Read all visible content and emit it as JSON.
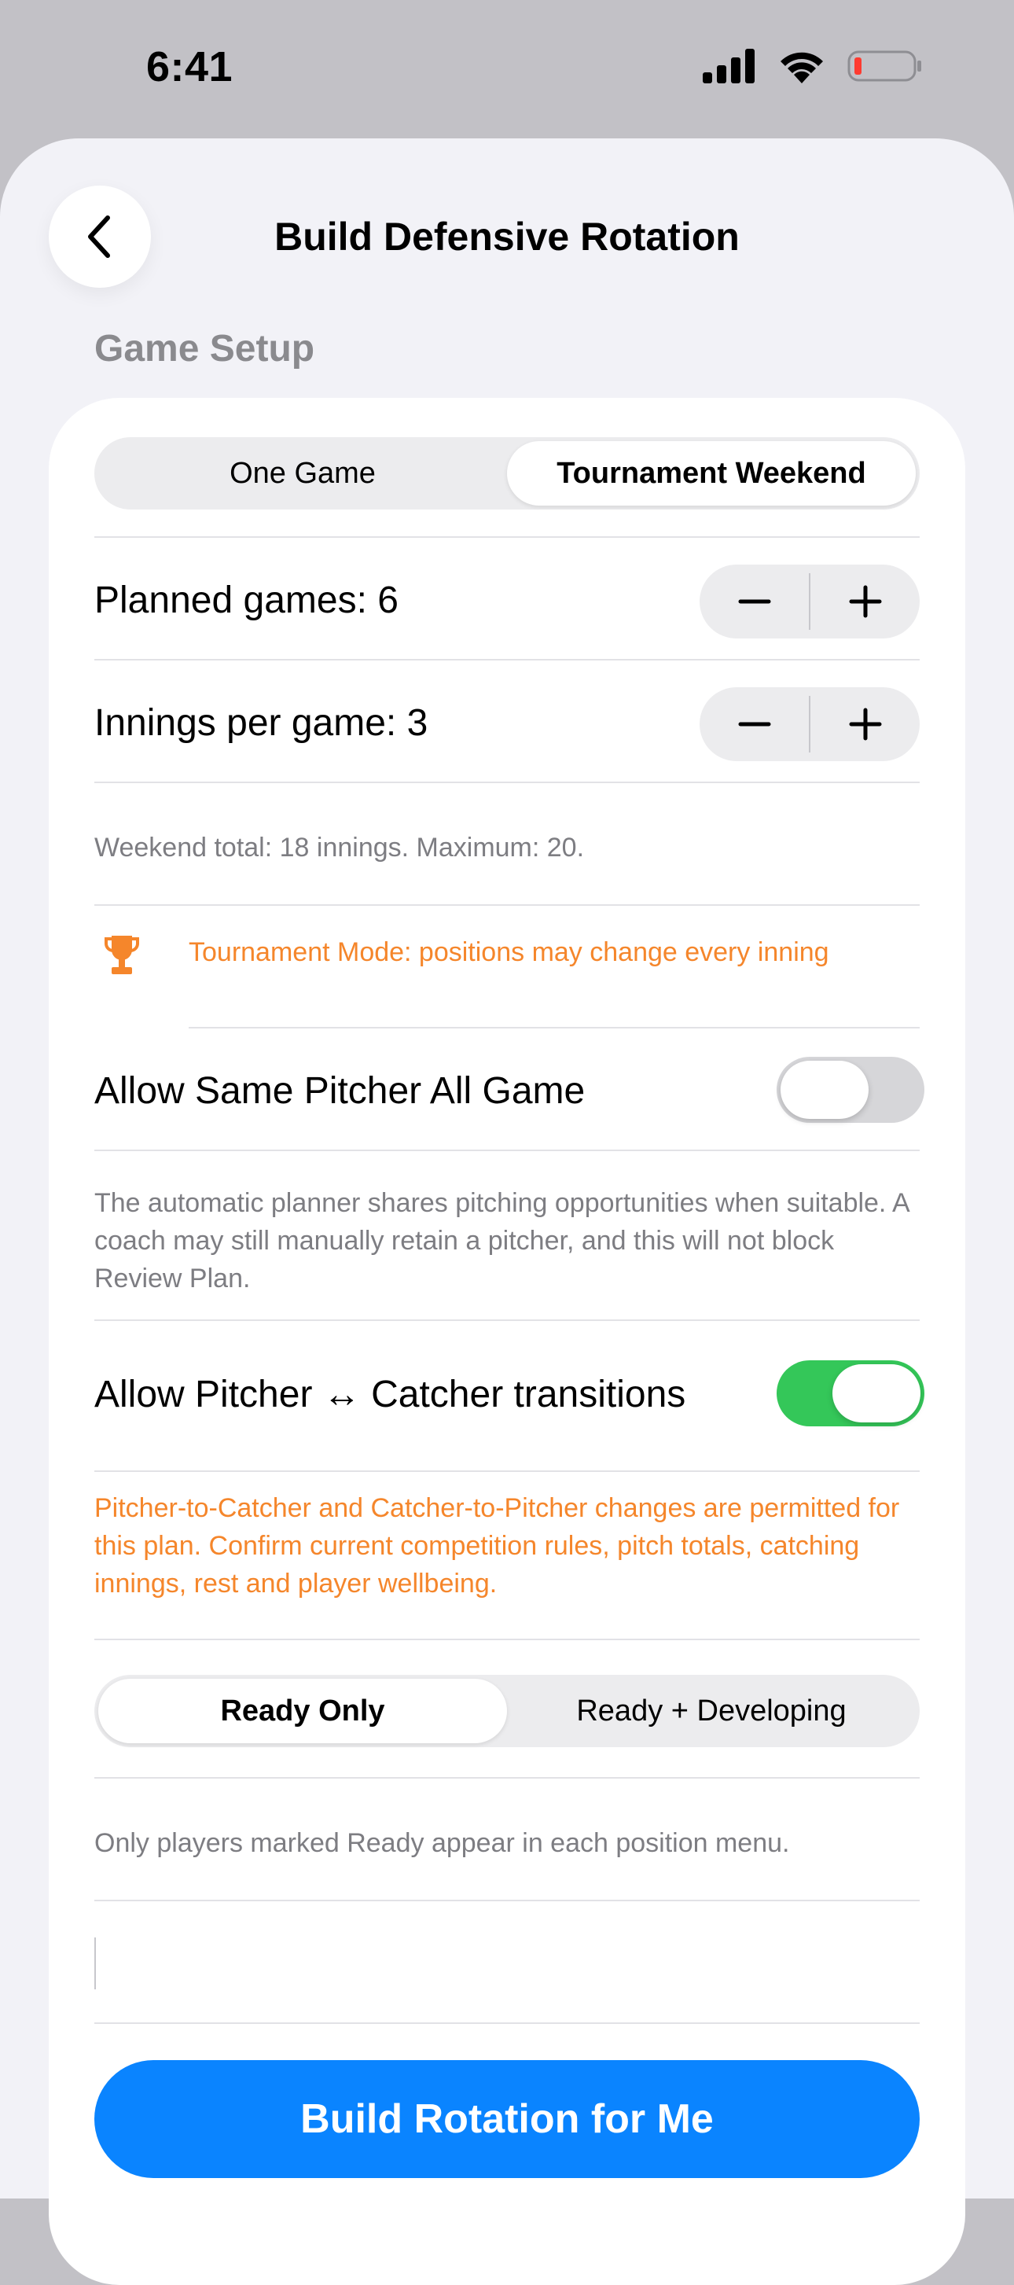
{
  "status_bar": {
    "time": "6:41"
  },
  "nav": {
    "title": "Build Defensive Rotation"
  },
  "section": {
    "header": "Game Setup"
  },
  "game_mode": {
    "options": [
      "One Game",
      "Tournament Weekend"
    ],
    "selected": "Tournament Weekend"
  },
  "planned_games": {
    "label": "Planned games: 6",
    "minus": "−",
    "plus": "+"
  },
  "innings": {
    "label": "Innings per game: 3",
    "minus": "−",
    "plus": "+"
  },
  "weekend_total": "Weekend total: 18 innings. Maximum: 20.",
  "tournament_notice": {
    "text": "Tournament Mode: positions may change every inning",
    "color": "#f5862b",
    "icon": "trophy-icon"
  },
  "same_pitcher": {
    "label": "Allow Same Pitcher All Game",
    "on": false,
    "footnote": "The automatic planner shares pitching opportunities when suitable. A coach may still manually retain a pitcher, and this will not block Review Plan."
  },
  "pitcher_catcher": {
    "label": "Allow Pitcher ↔ Catcher transitions",
    "on": true,
    "footnote": "Pitcher-to-Catcher and Catcher-to-Pitcher changes are permitted for this plan. Confirm current competition rules, pitch totals, catching innings, rest and player wellbeing."
  },
  "readiness": {
    "options": [
      "Ready Only",
      "Ready + Developing"
    ],
    "selected": "Ready Only",
    "footnote": "Only players marked Ready appear in each position menu."
  },
  "notes_input": {
    "value": ""
  },
  "build_button": {
    "label": "Build Rotation for Me",
    "color": "#0a84ff"
  }
}
